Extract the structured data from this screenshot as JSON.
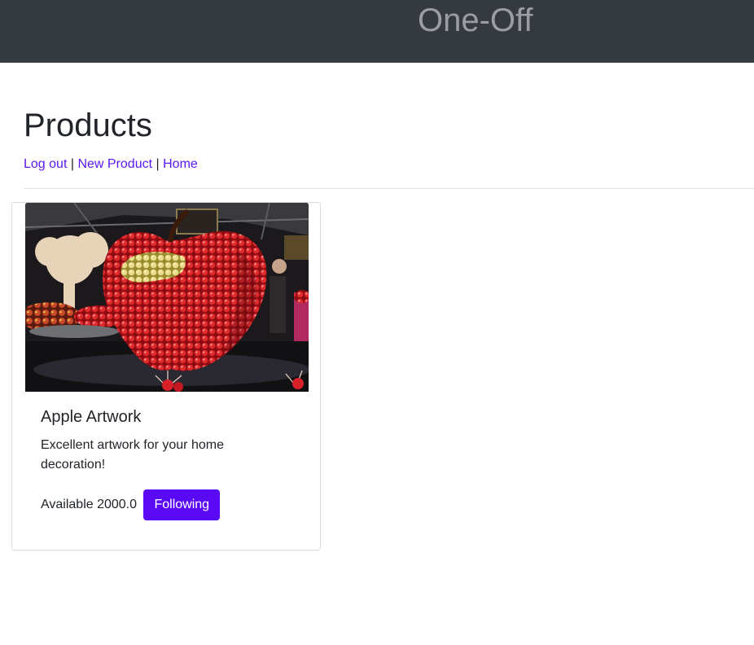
{
  "header": {
    "brand": "One-Off"
  },
  "page": {
    "title": "Products"
  },
  "nav": {
    "logout_label": "Log out",
    "new_product_label": "New Product",
    "home_label": "Home",
    "separator": "|"
  },
  "products": [
    {
      "image_alt": "Apple-shaped sculpture made of red apples",
      "title": "Apple Artwork",
      "description": "Excellent artwork for your home decoration!",
      "availability": "Available 2000.0",
      "follow_label": "Following"
    }
  ],
  "colors": {
    "topbar": "#343a40",
    "link": "#5b18f2",
    "button": "#5a09f5"
  }
}
